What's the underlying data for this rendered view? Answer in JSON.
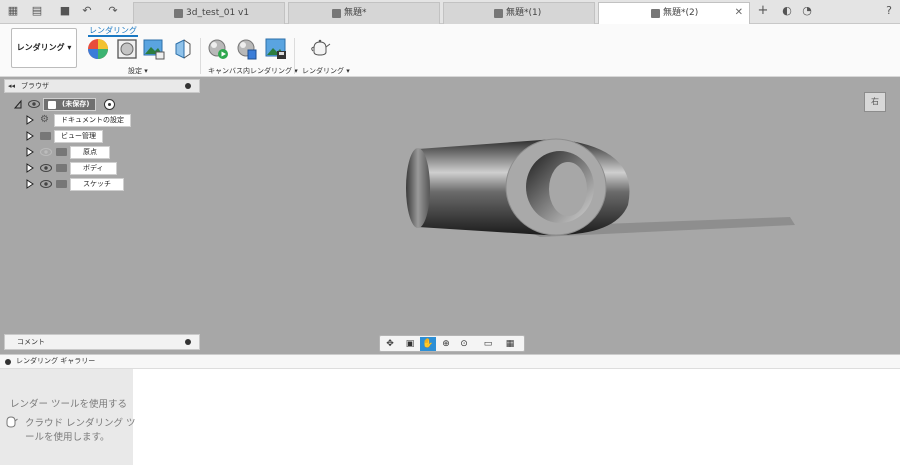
{
  "tabs": [
    {
      "label": "3d_test_01 v1",
      "active": false
    },
    {
      "label": "無題*",
      "active": false
    },
    {
      "label": "無題*(1)",
      "active": false
    },
    {
      "label": "無題*(2)",
      "active": true
    }
  ],
  "ribbon": {
    "workspace": "レンダリング ▾",
    "active_tab": "レンダリング",
    "groups": [
      {
        "label": "設定 ▾"
      },
      {
        "label": "キャンバス内レンダリング ▾"
      },
      {
        "label": "レンダリング ▾"
      }
    ]
  },
  "browser": {
    "title": "ブラウザ",
    "root": "(未保存)",
    "items": [
      {
        "label": "ドキュメントの設定",
        "icon": "gear-icon"
      },
      {
        "label": "ビュー管理",
        "icon": "folder-icon"
      },
      {
        "label": "原点",
        "icon": "folder-icon"
      },
      {
        "label": "ボディ",
        "icon": "folder-icon"
      },
      {
        "label": "スケッチ",
        "icon": "folder-icon"
      }
    ]
  },
  "viewcube": {
    "face": "右"
  },
  "comments": {
    "label": "コメント"
  },
  "gallery": {
    "title": "レンダリング ギャラリー",
    "line1": "レンダー ツールを使用する",
    "line2": "クラウド レンダリング ツ",
    "line3": "ールを使用します。"
  },
  "colors": {
    "accent": "#1a78c2",
    "viewport": "#a7a7a7",
    "nav_selected": "#2d8fd5"
  }
}
